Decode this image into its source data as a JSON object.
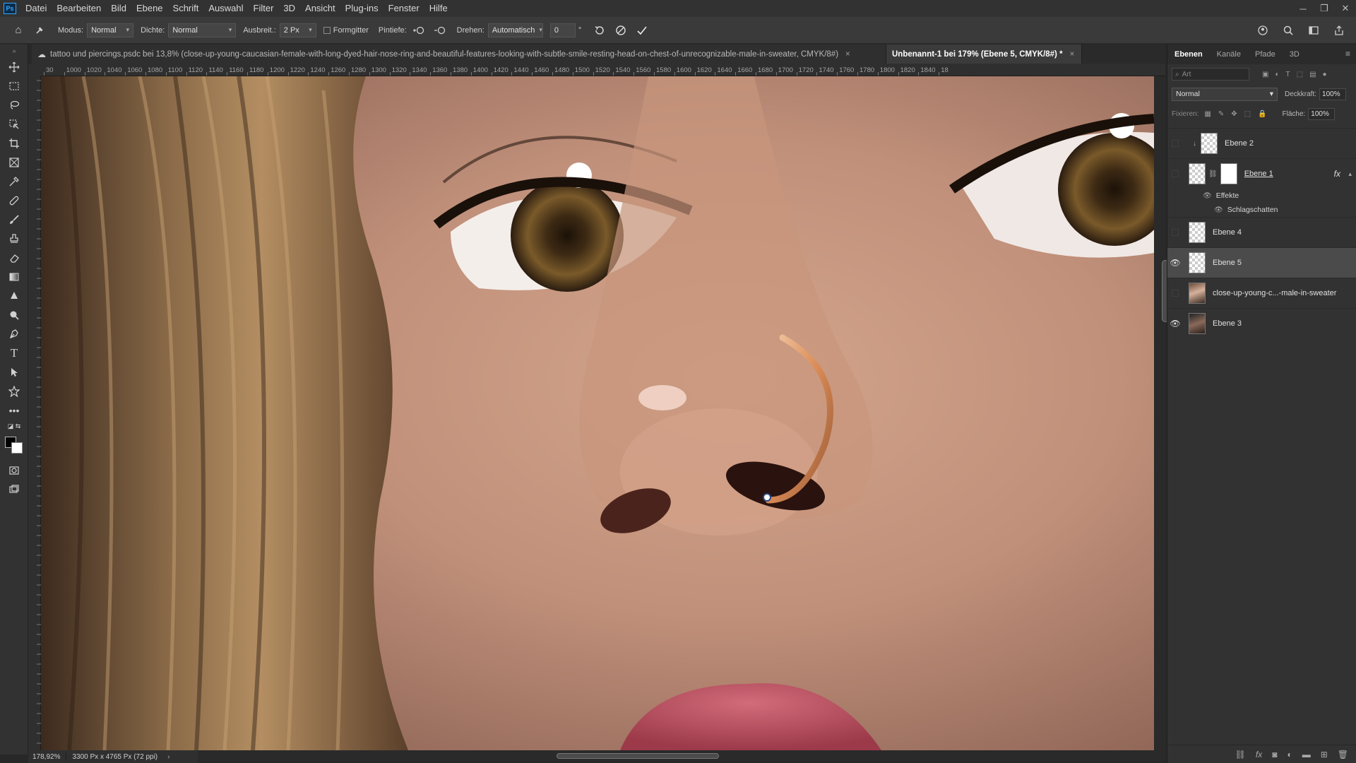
{
  "app": {
    "logo": "Ps"
  },
  "menu": [
    "Datei",
    "Bearbeiten",
    "Bild",
    "Ebene",
    "Schrift",
    "Auswahl",
    "Filter",
    "3D",
    "Ansicht",
    "Plug-ins",
    "Fenster",
    "Hilfe"
  ],
  "options": {
    "modus_label": "Modus:",
    "modus_value": "Normal",
    "dichte_label": "Dichte:",
    "dichte_value": "Normal",
    "ausbreitung_label": "Ausbreit.:",
    "ausbreitung_value": "2 Px",
    "formgitter_label": "Formgitter",
    "pintiefe_label": "Pintiefe:",
    "drehen_label": "Drehen:",
    "drehen_value": "Automatisch",
    "angle_value": "0",
    "degree": "°"
  },
  "tabs": [
    {
      "label": "tattoo und piercings.psdc bei 13,8% (close-up-young-caucasian-female-with-long-dyed-hair-nose-ring-and-beautiful-features-looking-with-subtle-smile-resting-head-on-chest-of-unrecognizable-male-in-sweater, CMYK/8#)",
      "close": "×"
    },
    {
      "label": "Unbenannt-1 bei 179% (Ebene 5, CMYK/8#) *",
      "close": "×"
    }
  ],
  "ruler_labels": [
    "30",
    "1000",
    "1020",
    "1040",
    "1060",
    "1080",
    "1100",
    "1120",
    "1140",
    "1160",
    "1180",
    "1200",
    "1220",
    "1240",
    "1260",
    "1280",
    "1300",
    "1320",
    "1340",
    "1360",
    "1380",
    "1400",
    "1420",
    "1440",
    "1460",
    "1480",
    "1500",
    "1520",
    "1540",
    "1560",
    "1580",
    "1600",
    "1620",
    "1640",
    "1660",
    "1680",
    "1700",
    "1720",
    "1740",
    "1760",
    "1780",
    "1800",
    "1820",
    "1840",
    "18"
  ],
  "status": {
    "zoom": "178,92%",
    "doc_info": "3300 Px x 4765 Px (72 ppi)",
    "arrow": "›"
  },
  "panel": {
    "tabs": [
      "Ebenen",
      "Kanäle",
      "Pfade",
      "3D"
    ],
    "search_placeholder": "Art",
    "blend_mode": "Normal",
    "opacity_label": "Deckkraft:",
    "opacity_value": "100%",
    "lock_label": "Fixieren:",
    "fill_label": "Fläche:",
    "fill_value": "100%",
    "layers": [
      {
        "name": "Ebene 2",
        "visible": false
      },
      {
        "name": "Ebene 1",
        "visible": false,
        "fx": "fx"
      },
      {
        "name": "Ebene 4",
        "visible": false
      },
      {
        "name": "Ebene 5",
        "visible": true
      },
      {
        "name": "close-up-young-c...-male-in-sweater",
        "visible": false
      },
      {
        "name": "Ebene 3",
        "visible": true
      }
    ],
    "effects_label": "Effekte",
    "drop_shadow_label": "Schlagschatten"
  },
  "icons": {
    "eye": "👁",
    "home": "⌂",
    "close": "✕",
    "minimize": "─",
    "restore": "❐"
  }
}
